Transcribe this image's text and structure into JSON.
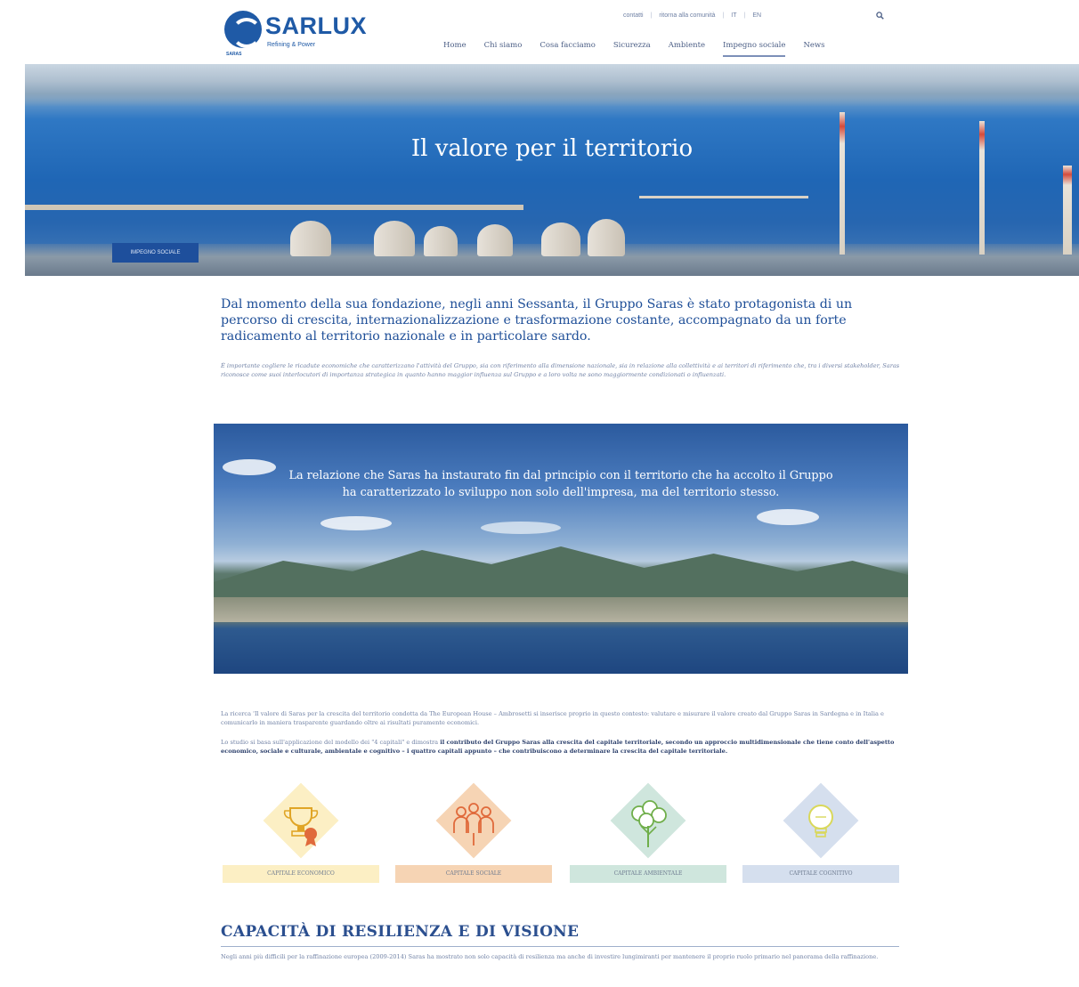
{
  "brand": {
    "name": "SARLUX",
    "tagline": "Refining & Power",
    "small_mark": "SARAS",
    "color": "#1f5aa6"
  },
  "util_nav": {
    "contacts": "contatti",
    "sep1": "|",
    "group": "ritorna alla comunità",
    "sep2": "|",
    "lang_it": "IT",
    "sep3": "|",
    "lang_en": "EN"
  },
  "main_nav": {
    "items": [
      "Home",
      "Chi siamo",
      "Cosa facciamo",
      "Sicurezza",
      "Ambiente",
      "Impegno sociale",
      "News"
    ],
    "active_index": 5
  },
  "hero": {
    "title": "Il valore per il territorio",
    "badge": "IMPEGNO SOCIALE"
  },
  "intro": {
    "heading": "Dal momento della sua fondazione, negli anni Sessanta, il Gruppo Saras è stato protagonista di un percorso di crescita, internazionalizzazione e trasformazione costante, accompagnato da un forte radicamento al territorio nazionale e in particolare sardo.",
    "text": "È importante cogliere le ricadute economiche che caratterizzano l'attività del Gruppo, sia con riferimento alla dimensione nazionale, sia in relazione alla collettività e ai territori di riferimento che, tra i diversi stakeholder, Saras riconosce come suoi interlocutori di importanza strategica in quanto hanno maggior influenza sul Gruppo e a loro volta ne sono maggiormente condizionati o influenzati."
  },
  "panorama": {
    "caption_line1": "La relazione che Saras ha instaurato fin dal principio con il territorio che ha accolto il Gruppo",
    "caption_line2": "ha caratterizzato lo sviluppo non solo dell'impresa, ma del territorio stesso."
  },
  "body": {
    "p1": "La ricerca 'Il valore di Saras per la crescita del territorio condotta da The European House – Ambrosetti si inserisce proprio in questo contesto: valutare e misurare il valore creato dal Gruppo Saras in Sardegna e in Italia e comunicarlo in maniera trasparente guardando oltre ai risultati puramente economici.",
    "p2_start": "Lo studio si basa sull'applicazione del modello dei \"4 capitali\" e dimostra ",
    "p2_bold": "il contributo del Gruppo Saras alla crescita del capitale territoriale, secondo un approccio multidimensionale che tiene conto dell'aspetto economico, sociale e culturale, ambientale e cognitivo – i quattro capitali appunto – che contribuiscono a determinare la crescita del capitale territoriale."
  },
  "capitals": [
    {
      "label": "CAPITALE ECONOMICO",
      "icon": "trophy-medal-icon",
      "color": "#fcefc4",
      "accent": "#e0a526"
    },
    {
      "label": "CAPITALE SOCIALE",
      "icon": "people-group-icon",
      "color": "#f6d4b4",
      "accent": "#e06a3b"
    },
    {
      "label": "CAPITALE AMBIENTALE",
      "icon": "trees-icon",
      "color": "#cfe6dd",
      "accent": "#6fae4a"
    },
    {
      "label": "CAPITALE COGNITIVO",
      "icon": "lightbulb-icon",
      "color": "#d5dfee",
      "accent": "#d9d85a"
    }
  ],
  "section": {
    "title": "CAPACITÀ DI RESILIENZA E DI VISIONE",
    "text": "Negli anni più difficili per la raffinazione europea (2009-2014) Saras ha mostrato non solo capacità di resilienza ma anche di investire lungimiranti per mantenere il proprio ruolo primario nel panorama della raffinazione."
  }
}
